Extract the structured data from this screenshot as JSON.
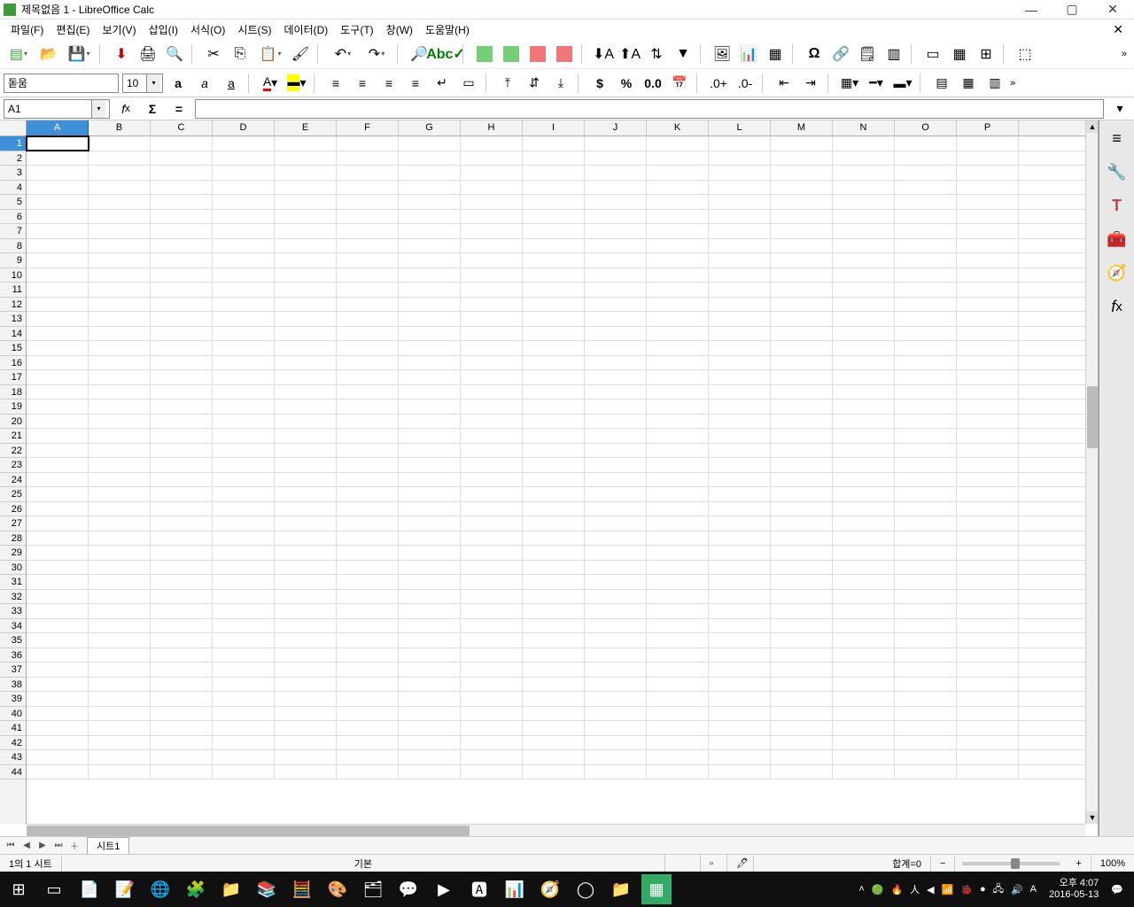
{
  "window": {
    "title": "제목없음 1 - LibreOffice Calc"
  },
  "menu": {
    "file": "파일(F)",
    "edit": "편집(E)",
    "view": "보기(V)",
    "insert": "삽입(I)",
    "format": "서식(O)",
    "sheet": "시트(S)",
    "data": "데이터(D)",
    "tools": "도구(T)",
    "window": "창(W)",
    "help": "도움말(H)"
  },
  "format_toolbar": {
    "font_name": "돋움",
    "font_size": "10"
  },
  "cellref": {
    "value": "A1"
  },
  "columns": [
    "A",
    "B",
    "C",
    "D",
    "E",
    "F",
    "G",
    "H",
    "I",
    "J",
    "K",
    "L",
    "M",
    "N",
    "O",
    "P"
  ],
  "rows_count": 44,
  "active_cell": "A1",
  "sheet_tabs": {
    "tab1": "시트1"
  },
  "statusbar": {
    "sheet_info": "1의 1 시트",
    "style": "기본",
    "sum": "합계=0",
    "zoom": "100%"
  },
  "tray": {
    "time": "오후 4:07",
    "date": "2016-05-13",
    "ime": "A"
  }
}
